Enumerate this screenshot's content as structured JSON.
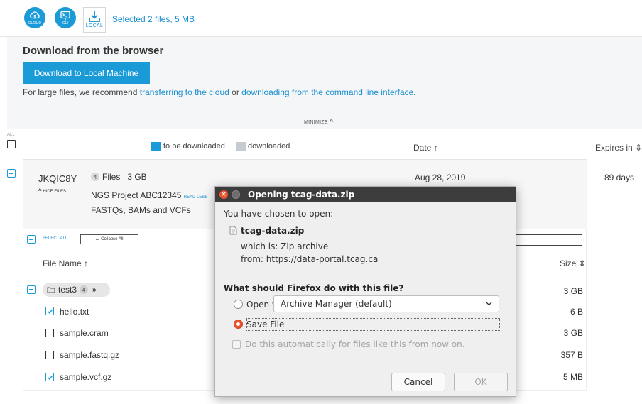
{
  "topbar": {
    "cloud_caption": "CLOUD",
    "cli_caption": "CLI",
    "local_caption": "LOCAL",
    "selected_text": "Selected 2 files, 5 MB"
  },
  "panel": {
    "title": "Download from the browser",
    "download_button": "Download to Local Machine",
    "note_prefix": "For large files, we recommend ",
    "note_link_cloud": "transferring to the cloud",
    "note_middle": " or ",
    "note_link_cli": "downloading from the command line interface",
    "note_suffix": ".",
    "minimize_label": "MINIMIZE"
  },
  "table_header": {
    "all_label": "ALL",
    "legend_to_be_downloaded": "to be downloaded",
    "legend_downloaded": "downloaded",
    "date_label": "Date ↑",
    "expires_label": "Expires in ⇕",
    "legend_colors": {
      "to_be_downloaded": "#1a9ad6",
      "downloaded": "#c5cad3"
    }
  },
  "request": {
    "id": "JKQIC8Y",
    "hide_files": "HIDE FILES",
    "file_count": "4",
    "files_label": "Files",
    "size": "3 GB",
    "desc_line1": "NGS Project ABC12345",
    "read_less": "READ LESS",
    "desc_line2": "FASTQs, BAMs and VCFs",
    "date": "Aug 28, 2019",
    "expires": "89 days"
  },
  "file_list": {
    "select_all": "SELECT ALL",
    "collapse_all": "Collapse All",
    "file_name_header": "File Name ↑",
    "size_header": "Size ⇕",
    "folder": {
      "name": "test3",
      "count": "4",
      "size": "3 GB"
    },
    "files": [
      {
        "name": "hello.txt",
        "size": "6 B",
        "checked": true
      },
      {
        "name": "sample.cram",
        "size": "3 GB",
        "checked": false
      },
      {
        "name": "sample.fastq.gz",
        "size": "357 B",
        "checked": false
      },
      {
        "name": "sample.vcf.gz",
        "size": "5 MB",
        "checked": true
      }
    ]
  },
  "dialog": {
    "title": "Opening tcag-data.zip",
    "chosen_text": "You have chosen to open:",
    "filename": "tcag-data.zip",
    "which_is": "which is: Zip archive",
    "from": "from: https://data-portal.tcag.ca",
    "question": "What should Firefox do with this file?",
    "open_with_label": "Open with",
    "app_selected": "Archive Manager (default)",
    "save_file_label": "Save File",
    "auto_label": "Do this automatically for files like this from now on.",
    "cancel_label": "Cancel",
    "ok_label": "OK"
  },
  "colors": {
    "accent": "#1a9ad6",
    "link": "#1a8fd0",
    "dialog_titlebar": "#3c3c3c",
    "radio_selected": "#e8542d"
  }
}
